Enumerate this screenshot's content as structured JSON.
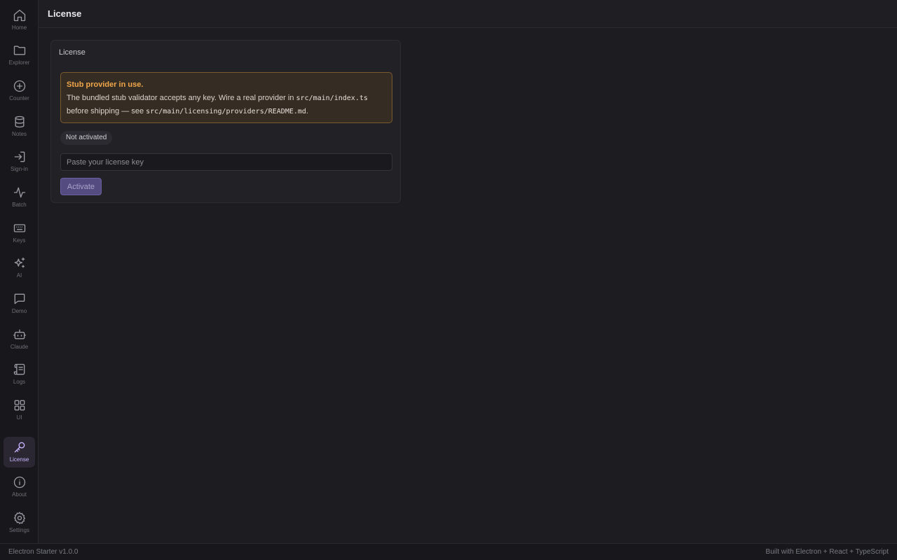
{
  "sidebar": {
    "items": [
      {
        "label": "Home",
        "icon": "home-icon"
      },
      {
        "label": "Explorer",
        "icon": "folder-icon"
      },
      {
        "label": "Counter",
        "icon": "plus-circle-icon"
      },
      {
        "label": "Notes",
        "icon": "database-icon"
      },
      {
        "label": "Sign-in",
        "icon": "sign-in-icon"
      },
      {
        "label": "Batch",
        "icon": "activity-icon"
      },
      {
        "label": "Keys",
        "icon": "keyboard-icon"
      },
      {
        "label": "AI",
        "icon": "sparkles-icon"
      },
      {
        "label": "Demo",
        "icon": "message-square-icon"
      },
      {
        "label": "Claude",
        "icon": "bot-icon"
      },
      {
        "label": "Logs",
        "icon": "scroll-icon"
      },
      {
        "label": "UI",
        "icon": "grid-icon"
      },
      {
        "label": "License",
        "icon": "key-icon",
        "active": true
      },
      {
        "label": "About",
        "icon": "info-icon"
      },
      {
        "label": "Settings",
        "icon": "gear-icon"
      }
    ]
  },
  "header": {
    "title": "License"
  },
  "card": {
    "title": "License",
    "warning": {
      "title": "Stub provider in use.",
      "text_1": "The bundled stub validator accepts any key. Wire a real provider in ",
      "code_1": "src/main/index.ts",
      "text_2": "before shipping — see ",
      "code_2": "src/main/licensing/providers/README.md",
      "text_3": "."
    },
    "status": "Not activated",
    "input_placeholder": "Paste your license key",
    "input_value": "",
    "activate_label": "Activate"
  },
  "footer": {
    "version": "Electron Starter v1.0.0",
    "built_with": "Built with Electron + React + TypeScript"
  },
  "colors": {
    "accent": "#c8b6ff",
    "warning": "#f0a64a",
    "button": "#544c80"
  }
}
